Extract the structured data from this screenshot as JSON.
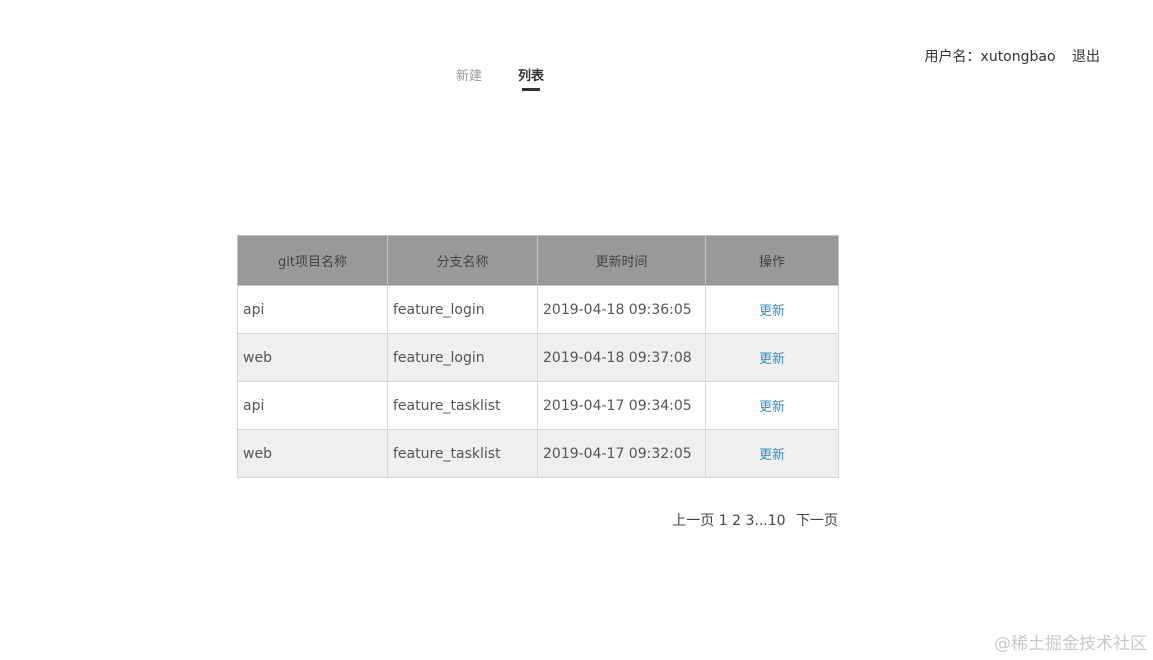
{
  "header": {
    "user_label": "用户名：xutongbao",
    "logout_label": "退出"
  },
  "tabs": [
    {
      "label": "新建",
      "active": false
    },
    {
      "label": "列表",
      "active": true
    }
  ],
  "table": {
    "columns": [
      "git项目名称",
      "分支名称",
      "更新时间",
      "操作"
    ],
    "rows": [
      {
        "project": "api",
        "branch": "feature_login",
        "time": "2019-04-18 09:36:05",
        "action": "更新"
      },
      {
        "project": "web",
        "branch": "feature_login",
        "time": "2019-04-18 09:37:08",
        "action": "更新"
      },
      {
        "project": "api",
        "branch": "feature_tasklist",
        "time": "2019-04-17 09:34:05",
        "action": "更新"
      },
      {
        "project": "web",
        "branch": "feature_tasklist",
        "time": "2019-04-17 09:32:05",
        "action": "更新"
      }
    ]
  },
  "pagination": {
    "prev_label": "上一页",
    "pages": "1 2 3...10",
    "next_label": "下一页"
  },
  "watermark": "@稀土掘金技术社区",
  "colors": {
    "header_bg": "#999999",
    "alt_row_bg": "#efefef",
    "link": "#2a8fd6"
  }
}
